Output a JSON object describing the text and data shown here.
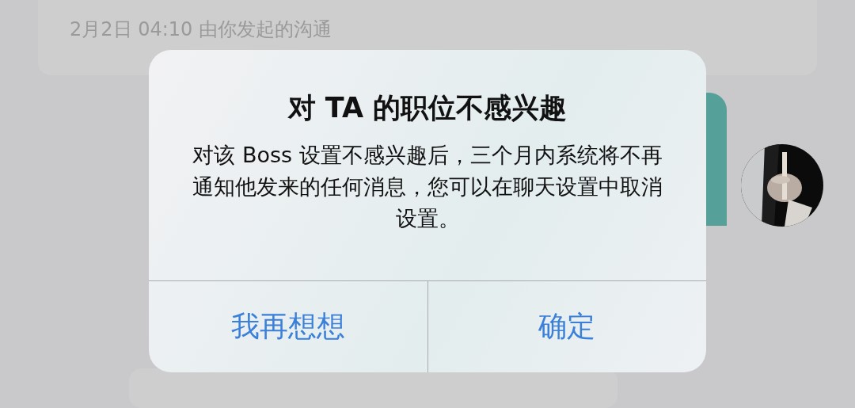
{
  "background": {
    "session_card": {
      "time": "2月2日 04:10 由你发起的沟通"
    }
  },
  "dialog": {
    "title": "对 TA 的职位不感兴趣",
    "message": "对该 Boss 设置不感兴趣后，三个月内系统将不再通知他发来的任何消息，您可以在聊天设置中取消设置。",
    "buttons": [
      {
        "label": "我再想想"
      },
      {
        "label": "确定"
      }
    ]
  }
}
